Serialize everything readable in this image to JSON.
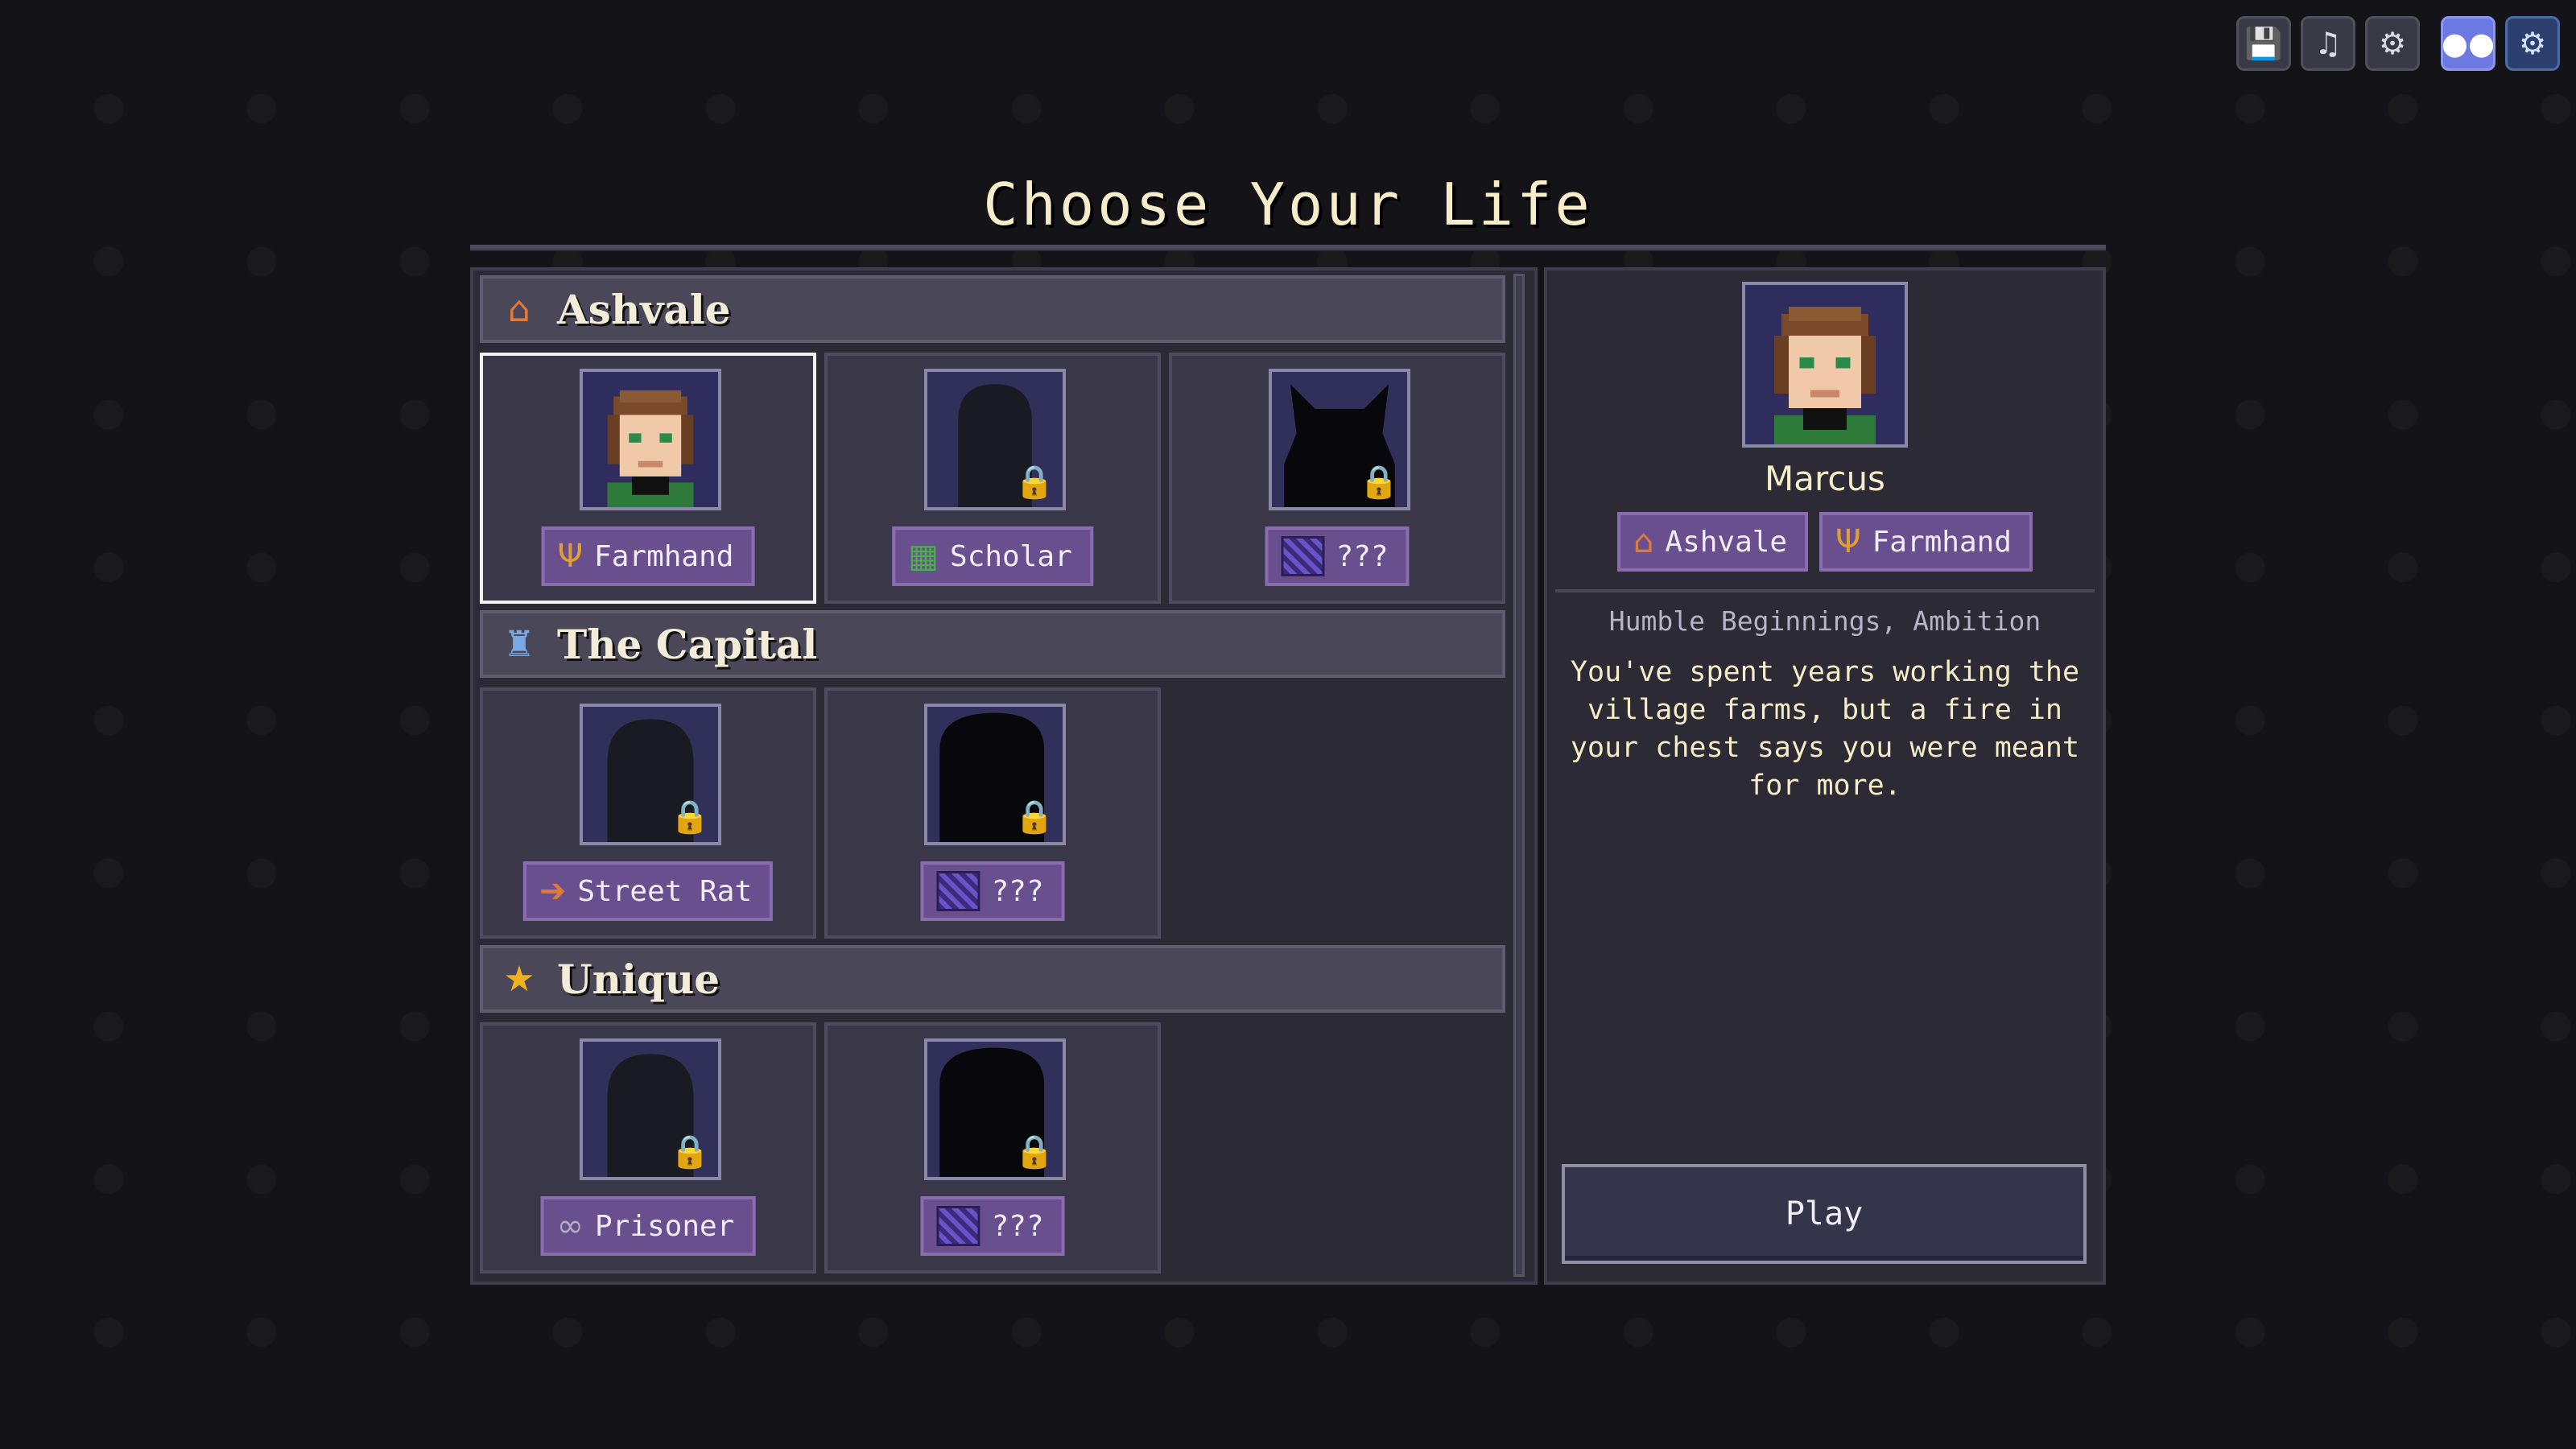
{
  "toolbar": {
    "icons": [
      "save-icon",
      "music-icon",
      "settings-icon",
      "discord-icon",
      "steam-icon"
    ]
  },
  "title": "Choose Your Life",
  "sections": [
    {
      "label": "Ashvale",
      "icon": "house-icon",
      "cards": [
        {
          "label": "Farmhand",
          "icon": "pitchfork-icon",
          "locked": false,
          "selected": true
        },
        {
          "label": "Scholar",
          "icon": "book-icon",
          "locked": true,
          "selected": false
        },
        {
          "label": "???",
          "icon": "mystery-icon",
          "locked": true,
          "selected": false
        }
      ]
    },
    {
      "label": "The Capital",
      "icon": "castle-icon",
      "cards": [
        {
          "label": "Street Rat",
          "icon": "dagger-icon",
          "locked": true,
          "selected": false
        },
        {
          "label": "???",
          "icon": "mystery-icon",
          "locked": true,
          "selected": false
        }
      ]
    },
    {
      "label": "Unique",
      "icon": "star-icon",
      "cards": [
        {
          "label": "Prisoner",
          "icon": "chain-icon",
          "locked": true,
          "selected": false
        },
        {
          "label": "???",
          "icon": "mystery-icon",
          "locked": true,
          "selected": false
        }
      ]
    }
  ],
  "detail": {
    "name": "Marcus",
    "origin": "Ashvale",
    "role": "Farmhand",
    "subtitle": "Humble Beginnings, Ambition",
    "description": "You've spent years working the village farms, but a fire in your chest says you were meant for more.",
    "play_label": "Play"
  },
  "colors": {
    "background": "#141317",
    "panel": "#2b2a35",
    "tag": "#6a4f8f",
    "title": "#f6edc8"
  }
}
